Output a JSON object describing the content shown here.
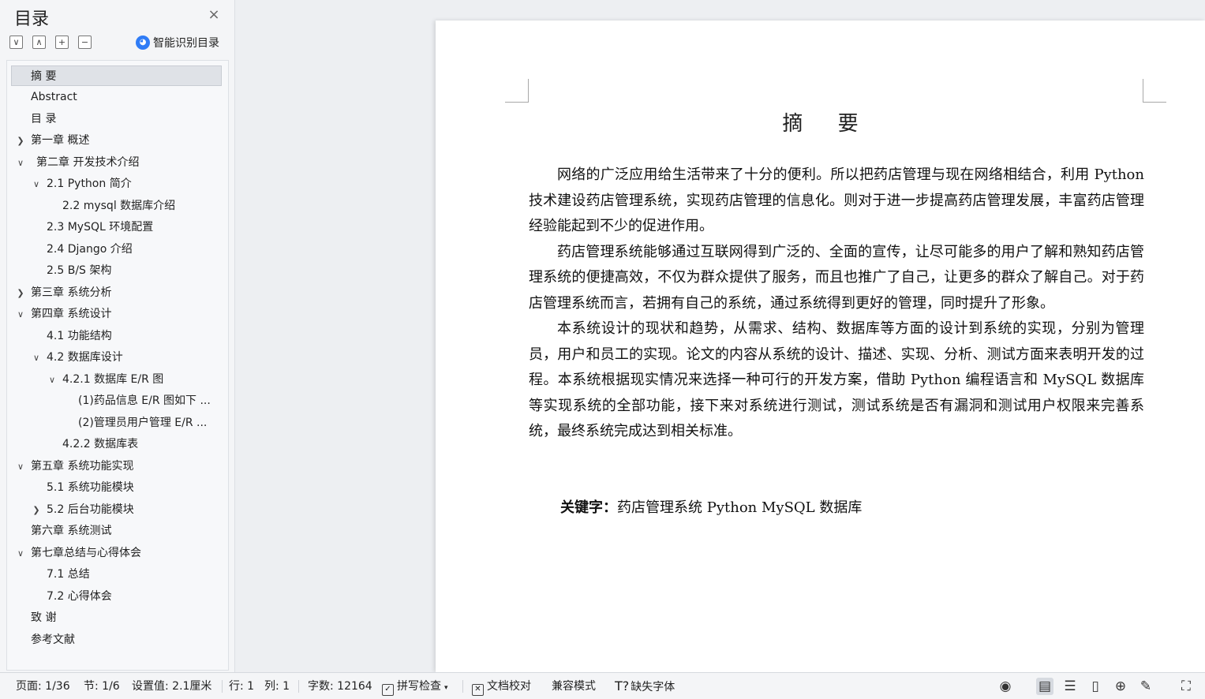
{
  "toc": {
    "title": "目录",
    "close_icon": "×",
    "smart_label": "智能识别目录",
    "tools": [
      "∨",
      "∧",
      "+",
      "−"
    ],
    "items": [
      {
        "label": "摘  要"
      },
      {
        "label": "Abstract"
      },
      {
        "label": "目  录"
      },
      {
        "label": "第一章 概述"
      },
      {
        "label": "第二章 开发技术介绍"
      },
      {
        "label": "2.1    Python 简介"
      },
      {
        "label": "2.2    mysql 数据库介绍"
      },
      {
        "label": "2.3    MySQL 环境配置"
      },
      {
        "label": "2.4    Django 介绍"
      },
      {
        "label": "2.5    B/S 架构"
      },
      {
        "label": "第三章 系统分析"
      },
      {
        "label": "第四章 系统设计"
      },
      {
        "label": "4.1 功能结构"
      },
      {
        "label": "4.2 数据库设计"
      },
      {
        "label": "4.2.1 数据库 E/R 图"
      },
      {
        "label": "(1)药品信息 E/R 图如下 ..."
      },
      {
        "label": "(2)管理员用户管理 E/R ..."
      },
      {
        "label": "4.2.2 数据库表"
      },
      {
        "label": "第五章 系统功能实现"
      },
      {
        "label": "5.1 系统功能模块"
      },
      {
        "label": "5.2 后台功能模块"
      },
      {
        "label": "第六章 系统测试"
      },
      {
        "label": "第七章总结与心得体会"
      },
      {
        "label": "7.1 总结"
      },
      {
        "label": "7.2 心得体会"
      },
      {
        "label": "致  谢"
      },
      {
        "label": "参考文献"
      }
    ]
  },
  "document": {
    "title": "摘 要",
    "paragraphs": [
      "网络的广泛应用给生活带来了十分的便利。所以把药店管理与现在网络相结合，利用 Python 技术建设药店管理系统，实现药店管理的信息化。则对于进一步提高药店管理发展，丰富药店管理经验能起到不少的促进作用。",
      "药店管理系统能够通过互联网得到广泛的、全面的宣传，让尽可能多的用户了解和熟知药店管理系统的便捷高效，不仅为群众提供了服务，而且也推广了自己，让更多的群众了解自己。对于药店管理系统而言，若拥有自己的系统，通过系统得到更好的管理，同时提升了形象。",
      "本系统设计的现状和趋势，从需求、结构、数据库等方面的设计到系统的实现，分别为管理员，用户和员工的实现。论文的内容从系统的设计、描述、实现、分析、测试方面来表明开发的过程。本系统根据现实情况来选择一种可行的开发方案，借助 Python 编程语言和 MySQL 数据库等实现系统的全部功能，接下来对系统进行测试，测试系统是否有漏洞和测试用户权限来完善系统，最终系统完成达到相关标准。"
    ],
    "keywords_label": "关键字：",
    "keywords": "药店管理系统 Python   MySQL 数据库"
  },
  "status": {
    "page": "页面: 1/36",
    "section": "节: 1/6",
    "setting": "设置值: 2.1厘米",
    "row": "行: 1",
    "col": "列: 1",
    "word_count": "字数: 12164",
    "spell_check": "拼写检查",
    "proofread": "文档校对",
    "compat_mode": "兼容模式",
    "missing_fonts": "缺失字体"
  }
}
